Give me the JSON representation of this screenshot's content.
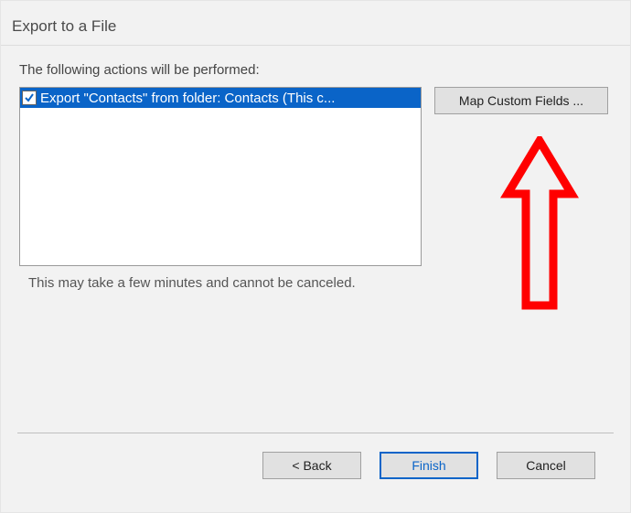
{
  "title": "Export to a File",
  "instruction": "The following actions will be performed:",
  "actions": {
    "item0": "Export \"Contacts\" from folder: Contacts (This c..."
  },
  "map_button": "Map Custom Fields ...",
  "warning": "This may take a few minutes and cannot be canceled.",
  "footer": {
    "back": "< Back",
    "finish": "Finish",
    "cancel": "Cancel"
  },
  "annotation": {
    "arrow_color": "#ff0000"
  }
}
